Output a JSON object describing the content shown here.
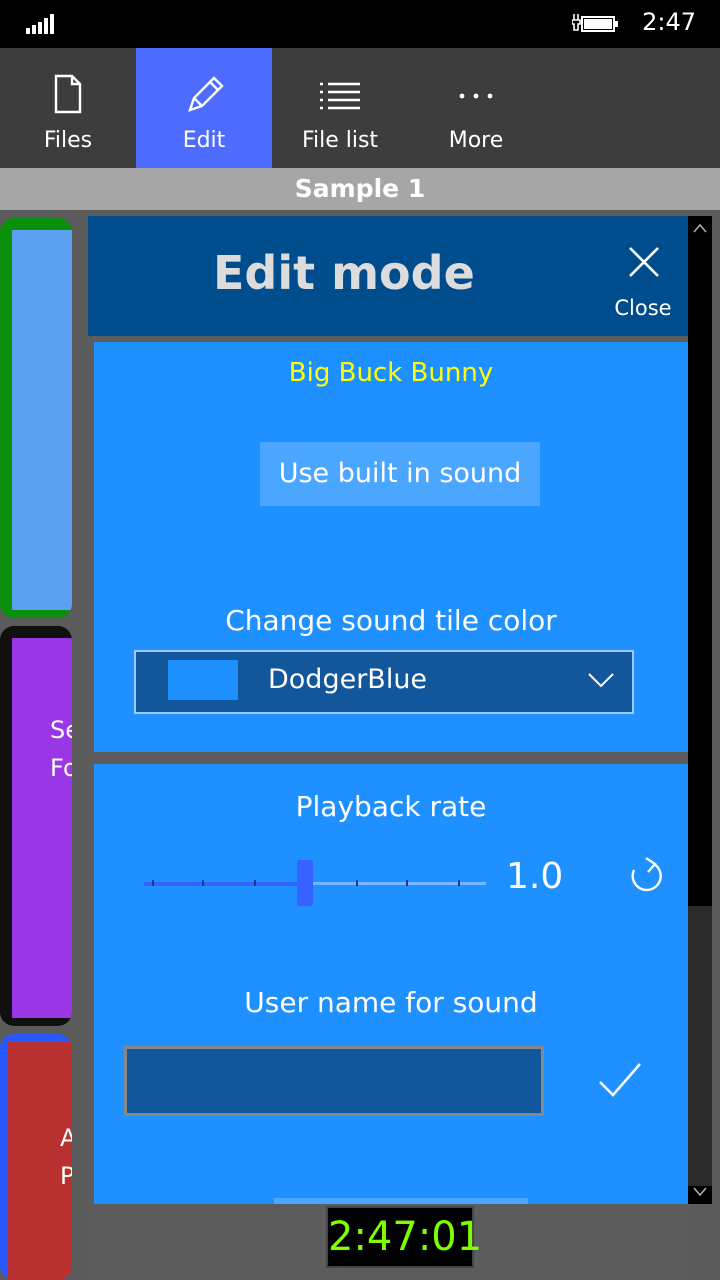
{
  "status": {
    "time": "2:47"
  },
  "appbar": {
    "items": [
      {
        "label": "Files",
        "icon": "file-icon"
      },
      {
        "label": "Edit",
        "icon": "pencil-icon",
        "active": true
      },
      {
        "label": "File list",
        "icon": "list-icon"
      },
      {
        "label": "More",
        "icon": "more-icon"
      }
    ]
  },
  "page": {
    "title": "Sample 1"
  },
  "background_tiles": {
    "purple_text": [
      "Se",
      "Fo"
    ],
    "red_text": [
      "A",
      "P"
    ]
  },
  "panel": {
    "title": "Edit mode",
    "close_label": "Close",
    "sound_name": "Big Buck Bunny",
    "builtin_button": "Use built in sound",
    "color_label": "Change sound tile color",
    "color_value": "DodgerBlue",
    "rate_label": "Playback rate",
    "rate_value": "1.0",
    "rate_fraction": 0.47,
    "name_label": "User name for sound",
    "name_value": ""
  },
  "timer": {
    "value": "2:47:01"
  },
  "colors": {
    "accent": "#4d6bff",
    "tile": "#1e90ff",
    "header": "#004d8e",
    "sound_name": "#ffff00",
    "timer": "#7dff00"
  }
}
